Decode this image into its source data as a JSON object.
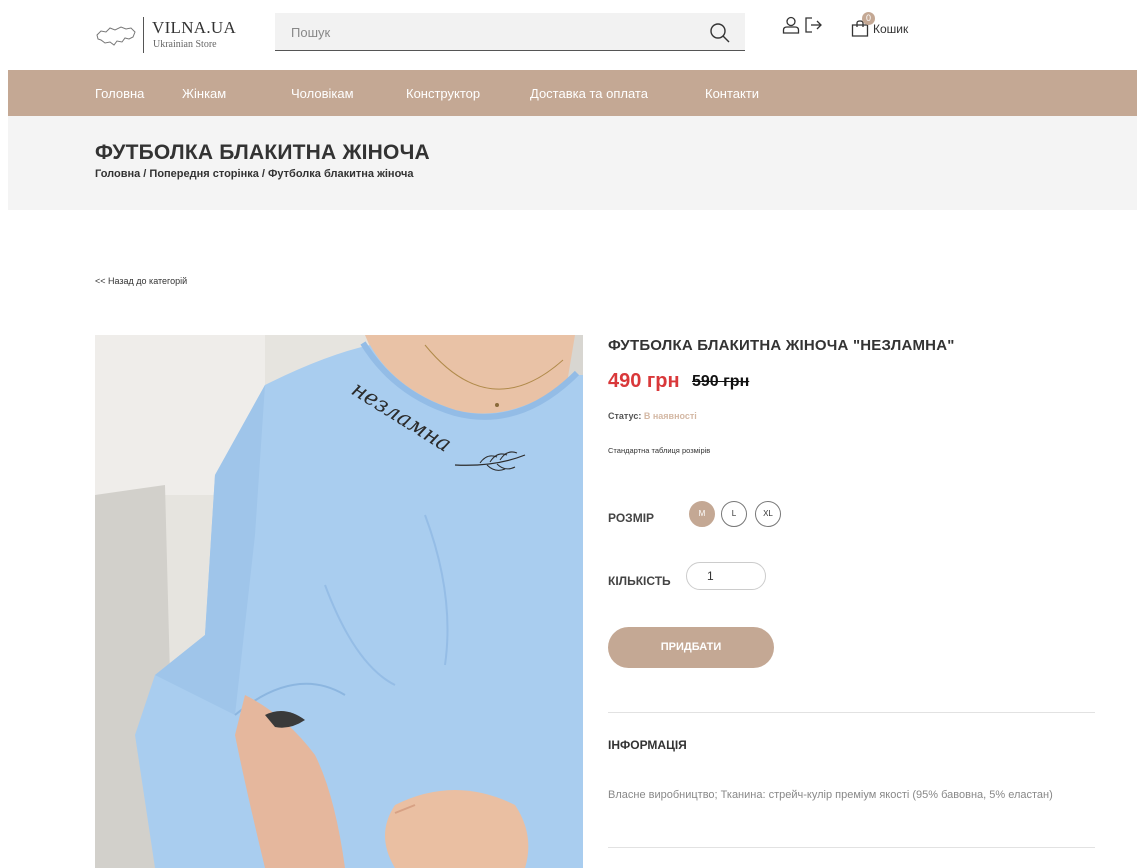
{
  "header": {
    "logo_title": "VILNA.UA",
    "logo_subtitle": "Ukrainian Store",
    "search_placeholder": "Пошук",
    "cart_count": "0",
    "cart_label": "Кошик"
  },
  "nav": {
    "items": [
      {
        "label": "Головна"
      },
      {
        "label": "Жінкам"
      },
      {
        "label": "Чоловікам"
      },
      {
        "label": "Конструктор"
      },
      {
        "label": "Доставка та оплата"
      },
      {
        "label": "Контакти"
      }
    ]
  },
  "band": {
    "title": "ФУТБОЛКА БЛАКИТНА ЖІНОЧА",
    "breadcrumb": [
      {
        "label": "Головна"
      },
      {
        "label": "Попередня сторінка"
      },
      {
        "label": "Футболка блакитна жіноча"
      }
    ],
    "breadcrumb_sep": " / "
  },
  "back_link": "<< Назад до категорій",
  "product": {
    "title": "ФУТБОЛКА БЛАКИТНА ЖІНОЧА \"НЕЗЛАМНА\"",
    "price_new": "490 грн",
    "price_old": "590 грн",
    "status_label": "Статус:",
    "status_value": "В наявності",
    "size_table_link": "Стандартна таблиця розмірів",
    "size_label": "РОЗМІР",
    "sizes": [
      {
        "label": "M",
        "selected": true
      },
      {
        "label": "L",
        "selected": false
      },
      {
        "label": "XL",
        "selected": false
      }
    ],
    "qty_label": "КІЛЬКІСТЬ",
    "qty_value": "1",
    "buy_label": "ПРИДБАТИ",
    "info_title": "ІНФОРМАЦІЯ",
    "info_text": "Власне виробництво; Тканина: стрейч-кулір преміум якості (95% бавовна, 5% еластан)",
    "shirt_text": "незламна"
  },
  "colors": {
    "accent": "#c4a894",
    "price_red": "#d9383a",
    "shirt_blue": "#a9cdef",
    "nav_text": "#ffffff"
  },
  "icons": [
    "ukraine-map-icon",
    "search-icon",
    "user-icon",
    "login-icon",
    "shopping-bag-icon"
  ]
}
